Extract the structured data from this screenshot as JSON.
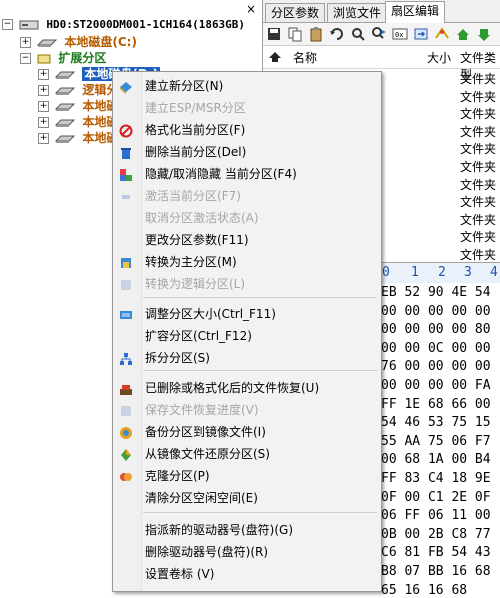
{
  "tree": {
    "disk_label": "HD0:ST2000DM001-1CH164(1863GB)",
    "items": [
      {
        "label": "本地磁盘(C:)"
      },
      {
        "label": "扩展分区"
      },
      {
        "label": "本地磁盘(D:)"
      },
      {
        "label": "逻辑分"
      },
      {
        "label": "本地磁"
      },
      {
        "label": "本地磁"
      },
      {
        "label": "本地磁"
      }
    ],
    "close_glyph": "×"
  },
  "tabs": [
    {
      "label": "分区参数"
    },
    {
      "label": "浏览文件"
    },
    {
      "label": "扇区编辑"
    }
  ],
  "file_list": {
    "col_name": "名称",
    "col_size": "大小",
    "col_type": "文件类型",
    "rows": [
      "文件夹",
      "文件夹",
      "文件夹",
      "文件夹",
      "文件夹",
      "文件夹",
      "文件夹",
      "文件夹",
      "文件夹",
      "文件夹",
      "文件夹"
    ]
  },
  "hex": {
    "columns": [
      "0",
      "1",
      "2",
      "3",
      "4"
    ],
    "rows": [
      "EB 52 90 4E 54",
      "00 00 00 00 00",
      "00 00 00 00 80",
      "00 00 0C 00 00",
      "76 00 00 00 00",
      "00 00 00 00 FA",
      "FF 1E 68 66 00",
      "54 46 53 75 15",
      "55 AA 75 06 F7",
      "00 68 1A 00 B4",
      "FF 83 C4 18 9E",
      "0F 00 C1 2E 0F",
      "06 FF 06 11 00",
      "0B 00 2B C8 77",
      "C6 81 FB 54 43",
      "B8 07 BB 16 68",
      "65 16 16 68"
    ]
  },
  "menu": {
    "items": [
      {
        "label": "建立新分区(N)",
        "enabled": true,
        "icon": "new-partition-icon"
      },
      {
        "label": "建立ESP/MSR分区",
        "enabled": false,
        "icon": ""
      },
      {
        "label": "格式化当前分区(F)",
        "enabled": true,
        "icon": "format-icon"
      },
      {
        "label": "删除当前分区(Del)",
        "enabled": true,
        "icon": "trash-icon"
      },
      {
        "label": "隐藏/取消隐藏 当前分区(F4)",
        "enabled": true,
        "icon": "hide-icon"
      },
      {
        "label": "激活当前分区(F7)",
        "enabled": false,
        "icon": "activate-icon"
      },
      {
        "label": "取消分区激活状态(A)",
        "enabled": false,
        "icon": ""
      },
      {
        "label": "更改分区参数(F11)",
        "enabled": true,
        "icon": ""
      },
      {
        "label": "转换为主分区(M)",
        "enabled": true,
        "icon": "convert-primary-icon"
      },
      {
        "label": "转换为逻辑分区(L)",
        "enabled": false,
        "icon": "convert-logical-icon"
      },
      {
        "label": "调整分区大小(Ctrl_F11)",
        "enabled": true,
        "icon": "resize-icon"
      },
      {
        "label": "扩容分区(Ctrl_F12)",
        "enabled": true,
        "icon": ""
      },
      {
        "label": "拆分分区(S)",
        "enabled": true,
        "icon": "split-icon"
      },
      {
        "label": "已删除或格式化后的文件恢复(U)",
        "enabled": true,
        "icon": "recover-icon"
      },
      {
        "label": "保存文件恢复进度(V)",
        "enabled": false,
        "icon": "save-progress-icon"
      },
      {
        "label": "备份分区到镜像文件(I)",
        "enabled": true,
        "icon": "backup-icon"
      },
      {
        "label": "从镜像文件还原分区(S)",
        "enabled": true,
        "icon": "restore-icon"
      },
      {
        "label": "克隆分区(P)",
        "enabled": true,
        "icon": "clone-icon"
      },
      {
        "label": "清除分区空闲空间(E)",
        "enabled": true,
        "icon": ""
      },
      {
        "label": "指派新的驱动器号(盘符)(G)",
        "enabled": true,
        "icon": ""
      },
      {
        "label": "删除驱动器号(盘符)(R)",
        "enabled": true,
        "icon": ""
      },
      {
        "label": "设置卷标 (V)",
        "enabled": true,
        "icon": ""
      }
    ]
  }
}
